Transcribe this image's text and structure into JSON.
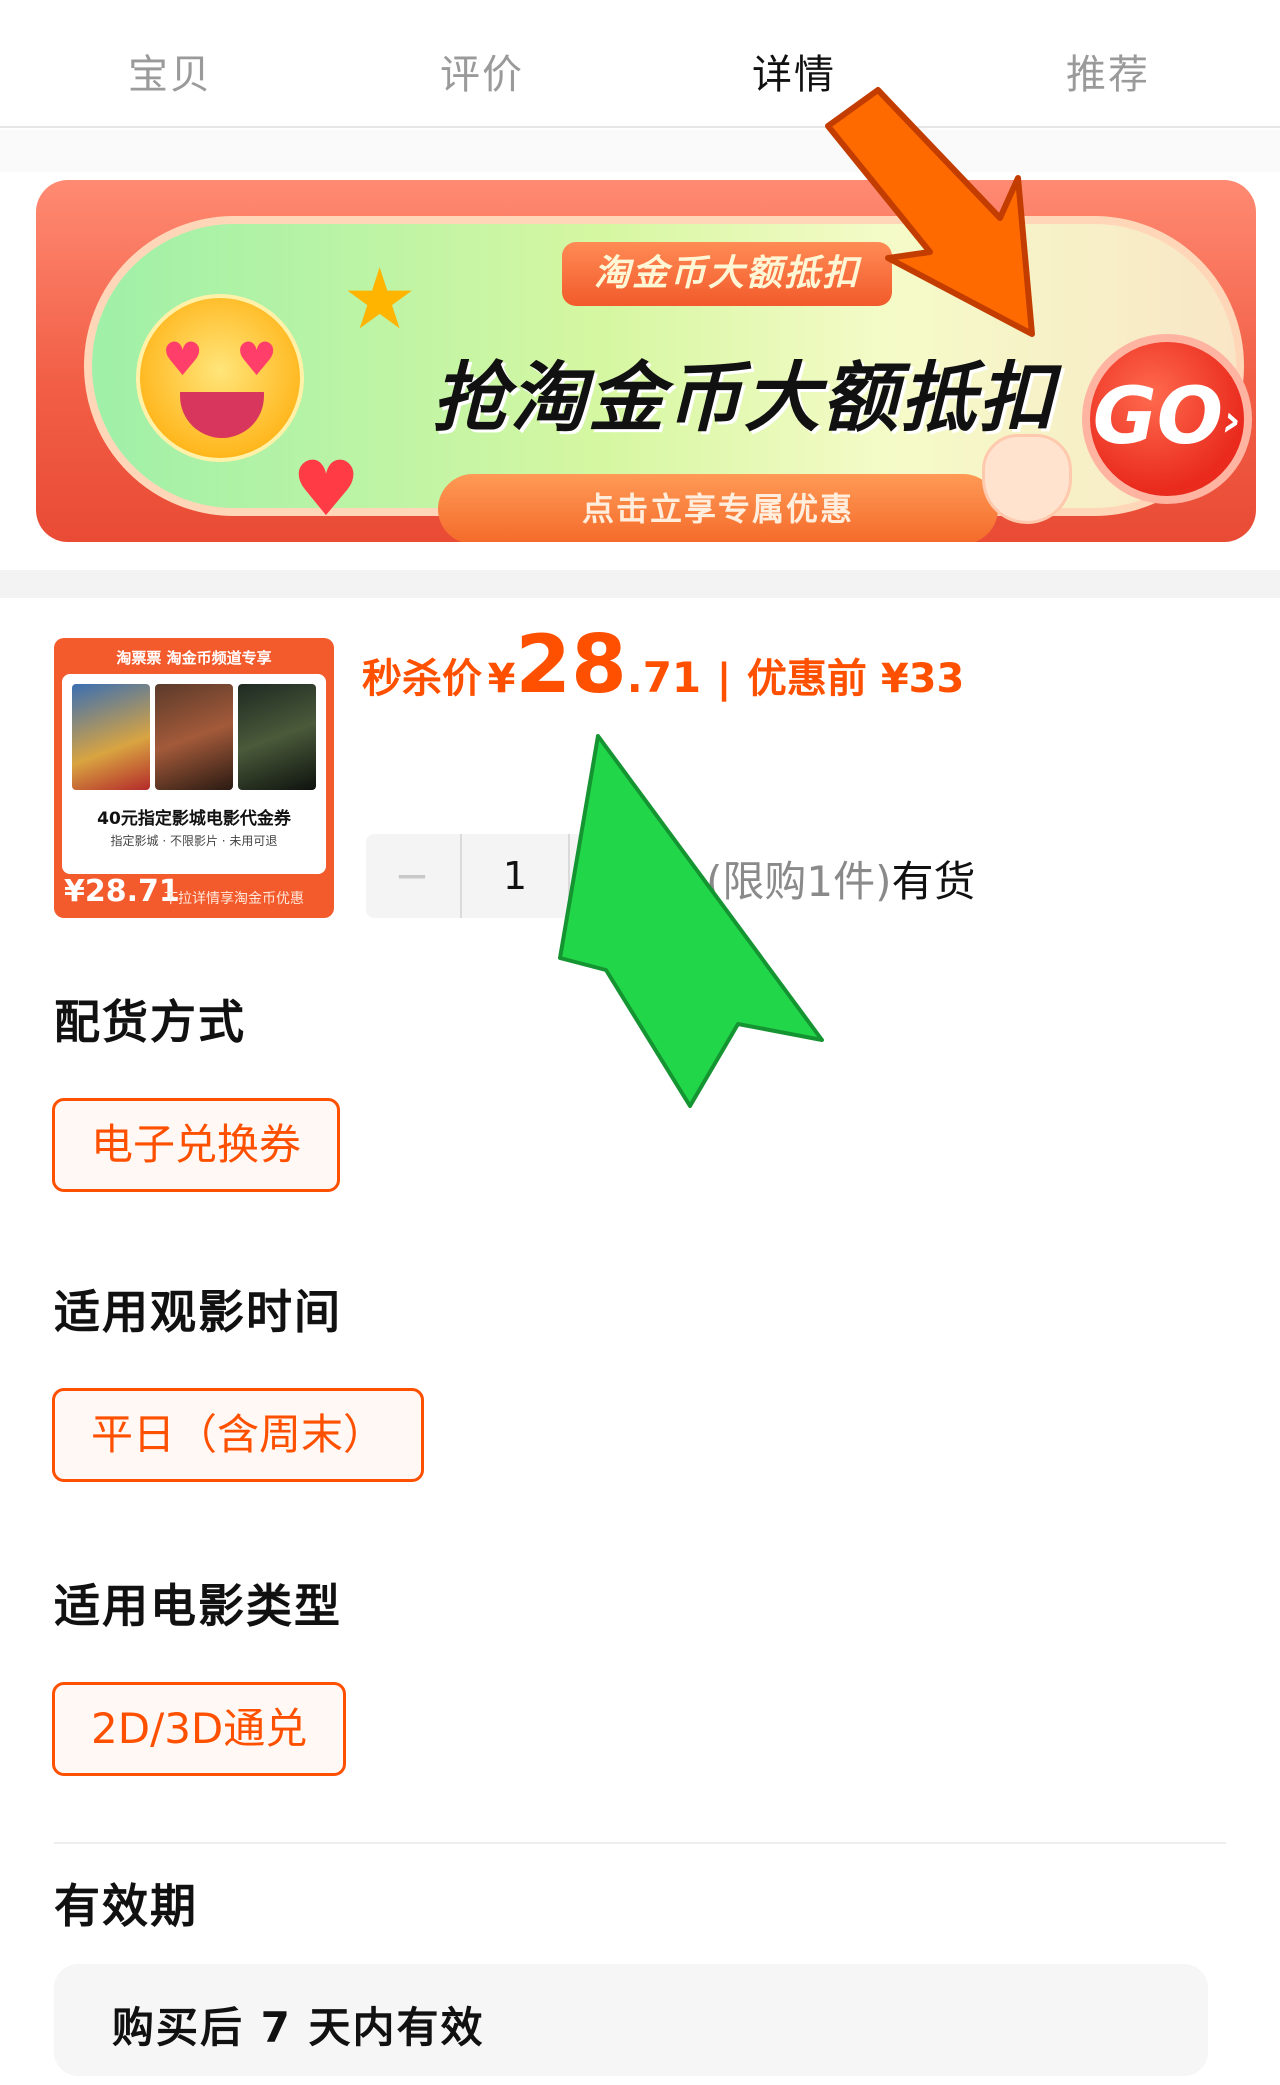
{
  "tabs": [
    {
      "label": "宝贝"
    },
    {
      "label": "评价"
    },
    {
      "label": "详情"
    },
    {
      "label": "推荐"
    }
  ],
  "active_tab": "详情",
  "banner": {
    "tag": "淘金币大额抵扣",
    "title": "抢淘金币大额抵扣",
    "subtitle": "点击立享专属优惠",
    "go_label": "GO"
  },
  "product": {
    "thumb": {
      "header": "淘票票 淘金币频道专享",
      "title": "40元指定影城电影代金券",
      "note": "指定影城 · 不限影片 · 未用可退",
      "price": "¥28.71",
      "footer": "下拉详情享淘金币优惠"
    },
    "price_label": "秒杀价",
    "price_currency": "¥",
    "price_int": "28",
    "price_dec": ".71",
    "price_separator": "|",
    "original_price": "优惠前 ¥33",
    "quantity": "1",
    "minus": "−",
    "plus": "+",
    "limit_text": "(限购1件)",
    "stock_text": "有货"
  },
  "sections": {
    "delivery": {
      "title": "配货方式",
      "option": "电子兑换券"
    },
    "time": {
      "title": "适用观影时间",
      "option": "平日（含周末）"
    },
    "type": {
      "title": "适用电影类型",
      "option": "2D/3D通兑"
    },
    "validity": {
      "title": "有效期",
      "value": "购买后 7 天内有效"
    }
  },
  "colors": {
    "accent": "#ff5000",
    "banner_red": "#f25f47",
    "annotation_green": "#22d64a",
    "annotation_orange": "#ff6a00"
  }
}
